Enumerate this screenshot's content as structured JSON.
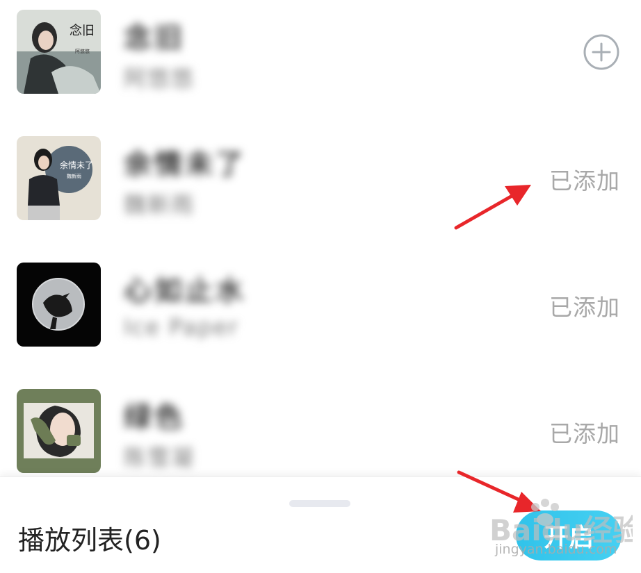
{
  "songs": [
    {
      "title": "念旧",
      "artist": "阿悠悠",
      "status": ""
    },
    {
      "title": "余情未了",
      "artist": "魏新雨",
      "status": "已添加"
    },
    {
      "title": "心如止水",
      "artist": "Ice Paper",
      "status": "已添加"
    },
    {
      "title": "绿色",
      "artist": "陈雪凝",
      "status": "已添加"
    }
  ],
  "covers": [
    {
      "text_main": "念旧",
      "text_sub": "阿悠悠"
    },
    {
      "text_main": "余情未了",
      "text_sub": "魏新雨"
    },
    {
      "text_main": "",
      "text_sub": ""
    },
    {
      "text_main": "",
      "text_sub": ""
    }
  ],
  "bottom_bar": {
    "playlist_title": "播放列表(6)",
    "open_button_label": "开启"
  },
  "watermark": {
    "logo_text": "Baidu经验",
    "url": "jingyan.baidu.com"
  },
  "colors": {
    "accent": "#31c3ea",
    "arrow": "#e8262a",
    "added_text": "#a8a8a8"
  }
}
